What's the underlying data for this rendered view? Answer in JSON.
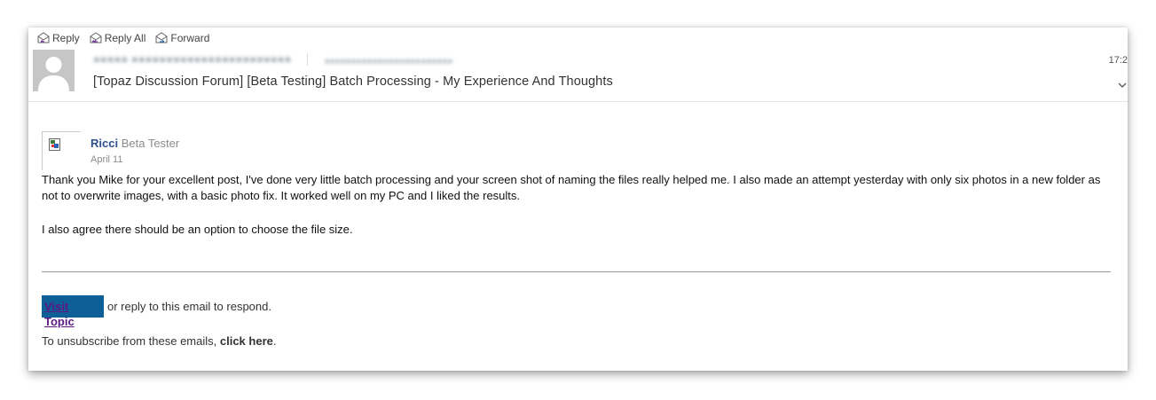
{
  "toolbar": {
    "reply_label": "Reply",
    "reply_all_label": "Reply All",
    "forward_label": "Forward"
  },
  "header": {
    "time": "17:2",
    "subject": "[Topaz Discussion Forum] [Beta Testing] Batch Processing - My Experience And Thoughts"
  },
  "post": {
    "author_name": "Ricci",
    "author_role": "Beta Tester",
    "date": "April 11",
    "paragraph1": "Thank you Mike for your excellent post, I've done very little batch processing and your screen shot of naming the files really helped me. I also made an attempt yesterday with only six photos in a new folder as not to overwrite images, with a basic photo fix. It worked well on my PC and I liked the results.",
    "paragraph2": "I also agree there should be an option to choose the file size."
  },
  "footer": {
    "visit_label": "Visit Topic",
    "respond_text": "or reply to this email to respond.",
    "unsubscribe_prefix": "To unsubscribe from these emails, ",
    "unsubscribe_link": "click here",
    "unsubscribe_suffix": "."
  },
  "colors": {
    "visit_button_bg": "#0c5f97",
    "author_name": "#2d4f8e"
  }
}
